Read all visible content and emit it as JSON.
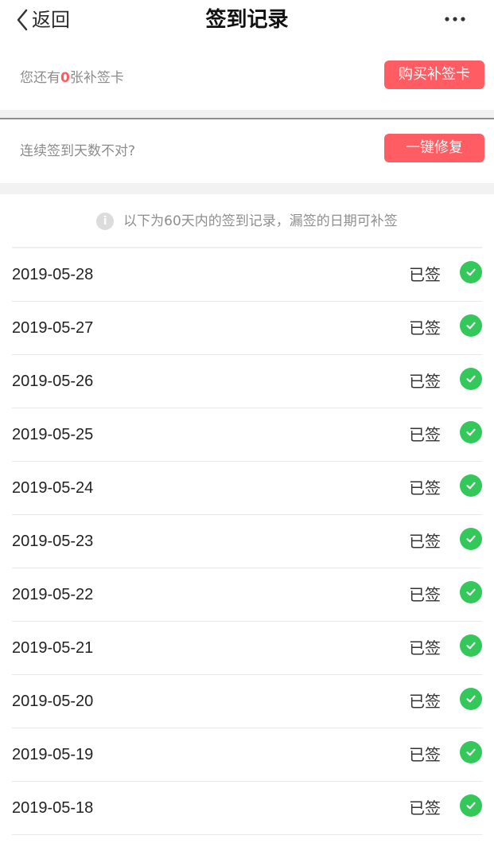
{
  "header": {
    "back_label": "返回",
    "title": "签到记录"
  },
  "card1": {
    "prefix": "您还有",
    "count": "0",
    "suffix": "张补签卡",
    "button_label": "购买补签卡"
  },
  "card2": {
    "label": "连续签到天数不对?",
    "button_label": "一键修复"
  },
  "info": {
    "icon_glyph": "i",
    "text": "以下为60天内的签到记录，漏签的日期可补签"
  },
  "records": [
    {
      "date": "2019-05-28",
      "status": "已签"
    },
    {
      "date": "2019-05-27",
      "status": "已签"
    },
    {
      "date": "2019-05-26",
      "status": "已签"
    },
    {
      "date": "2019-05-25",
      "status": "已签"
    },
    {
      "date": "2019-05-24",
      "status": "已签"
    },
    {
      "date": "2019-05-23",
      "status": "已签"
    },
    {
      "date": "2019-05-22",
      "status": "已签"
    },
    {
      "date": "2019-05-21",
      "status": "已签"
    },
    {
      "date": "2019-05-20",
      "status": "已签"
    },
    {
      "date": "2019-05-19",
      "status": "已签"
    },
    {
      "date": "2019-05-18",
      "status": "已签"
    }
  ],
  "colors": {
    "accent_red": "#ff5d63",
    "count_red": "#ff5a5f",
    "check_green": "#34c759"
  },
  "icons": {
    "back": "chevron-left-icon",
    "more": "more-icon",
    "info": "info-icon",
    "check": "check-icon"
  }
}
